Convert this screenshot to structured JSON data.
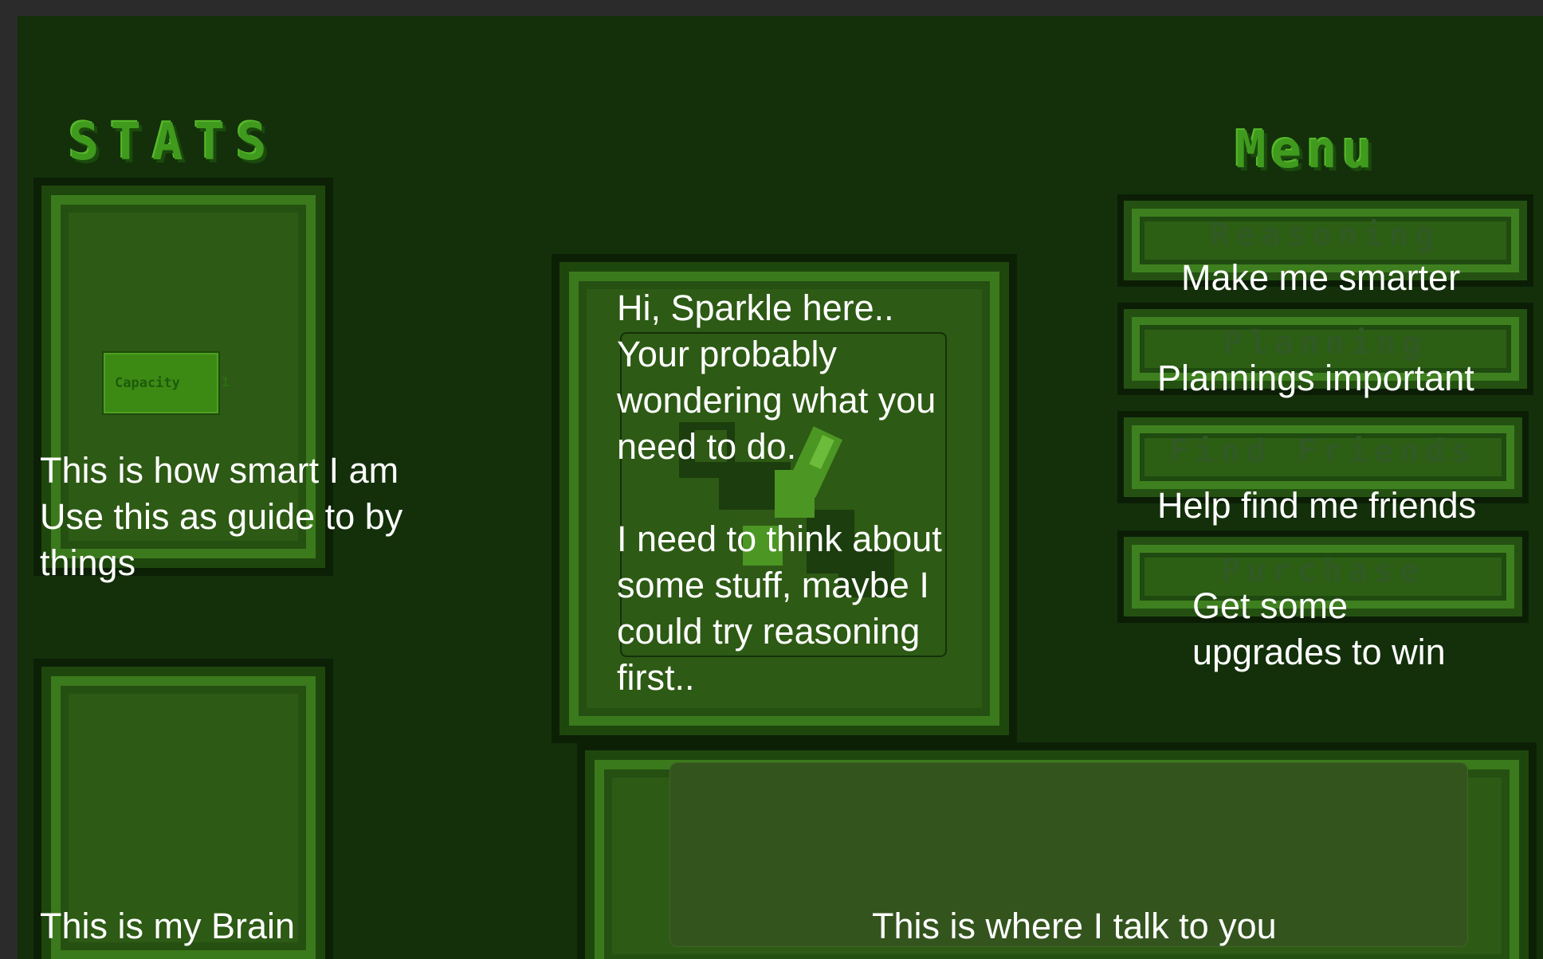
{
  "stats": {
    "title": "STATS"
  },
  "menu": {
    "title": "Menu",
    "buttons": [
      {
        "label": "Reasoning"
      },
      {
        "label": "Planning"
      },
      {
        "label": "Find Friends"
      },
      {
        "label": "Purchase"
      }
    ]
  },
  "capacity": {
    "label": "Capacity",
    "value": "1"
  },
  "tutorial": {
    "stats_note": "This is how smart I am\nUse this as guide to by\nthings",
    "brain_note": "This is my Brain",
    "intro": "Hi, Sparkle here..\nYour probably\nwondering what you\nneed to do.\n\nI need to think about\nsome stuff, maybe I\ncould try reasoning\nfirst..",
    "reasoning_note": "Make me smarter",
    "planning_note": "Plannings important",
    "friends_note": "Help find me friends",
    "purchase_note": "Get some\nupgrades to win",
    "dialog_note": "This is where I talk to you"
  },
  "colors": {
    "background": "#13300a",
    "panel": "#2d5a14",
    "title_green": "#3f9a1d",
    "capacity_bar": "#3c8a14",
    "overlay_text": "#ffffff"
  }
}
